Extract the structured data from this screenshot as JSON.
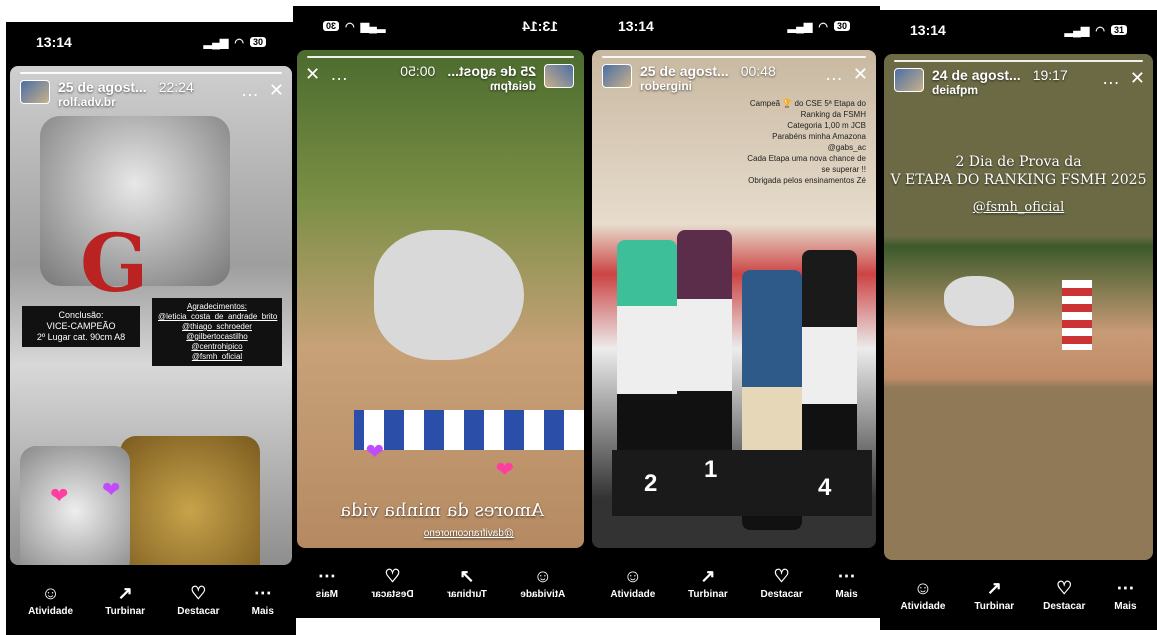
{
  "stories": [
    {
      "status_time": "13:14",
      "title": "25 de agost...",
      "time": "22:24",
      "user": "rolf.adv.br",
      "box_left": "Conclusão:\nVICE-CAMPEÃO\n2º Lugar cat. 90cm A8",
      "box_right": "Agradecimentos:\n@leticia_costa_de_andrade_brito\n@thiago_schroeder\n@gilbertocastilho\n@centrohipico\n@fsmh_oficial",
      "nav": [
        "Atividade",
        "Turbinar",
        "Destacar",
        "Mais"
      ]
    },
    {
      "status_time": "13:14",
      "title": "25 de agost...",
      "time": "00:50",
      "user": "deiafpm",
      "caption": "Amores da minha vida",
      "mention": "@davifrancomoreno",
      "nav": [
        "Atividade",
        "Turbinar",
        "Destacar",
        "Mais"
      ]
    },
    {
      "status_time": "13:14",
      "title": "25 de agost...",
      "time": "00:48",
      "user": "robergini",
      "caption": "Campeã 🏆 do CSE 5ª Etapa do\nRanking da FSMH\nCategoria 1,00 m JCB\nParabéns minha Amazona\n@gabs_ac\nCada Etapa uma nova chance de\nse superar !!\nObrigada pelos ensinamentos Zé",
      "podium": [
        "2",
        "1",
        "4"
      ],
      "nav": [
        "Atividade",
        "Turbinar",
        "Destacar",
        "Mais"
      ]
    },
    {
      "status_time": "13:14",
      "title": "24 de agost...",
      "time": "19:17",
      "user": "deiafpm",
      "caption_line1": "2 Dia de Prova da",
      "caption_line2": "V ETAPA DO RANKING FSMH 2025",
      "mention": "@fsmh_oficial",
      "nav": [
        "Atividade",
        "Turbinar",
        "Destacar",
        "Mais"
      ]
    }
  ]
}
